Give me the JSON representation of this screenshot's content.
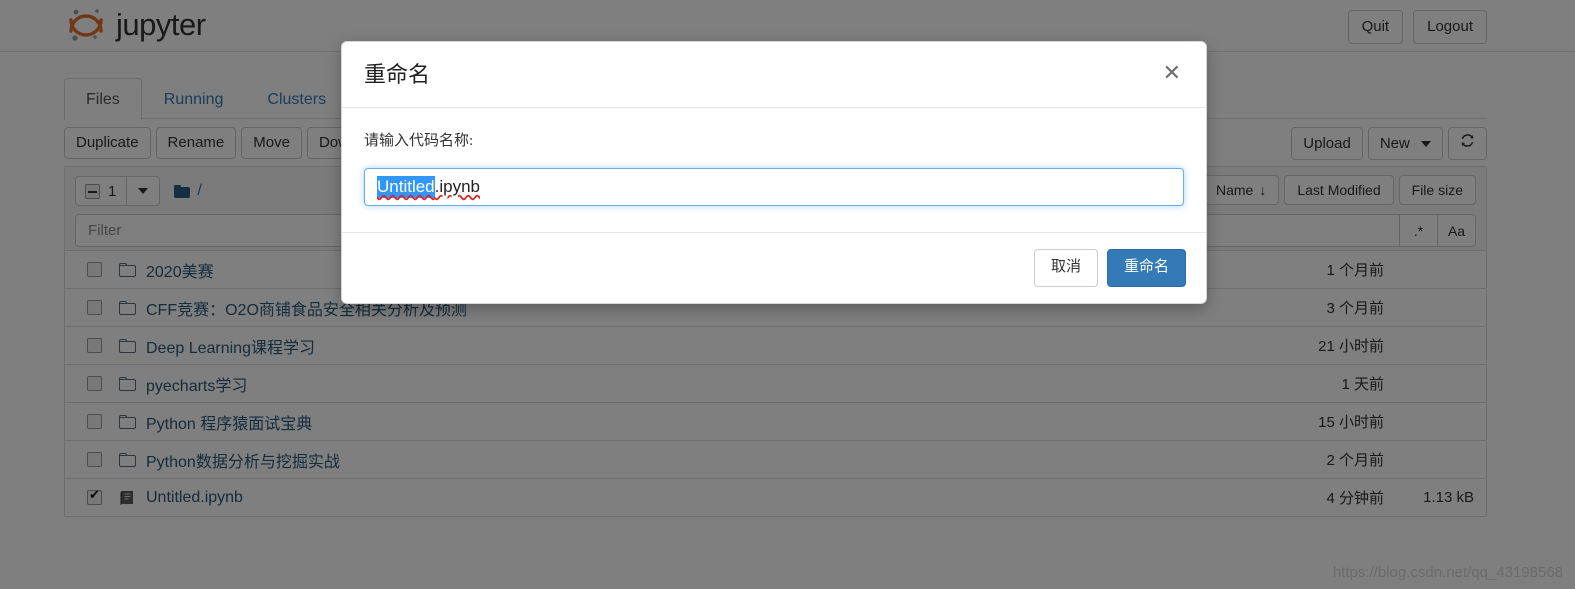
{
  "header": {
    "logo_text": "jupyter",
    "logo_icon": "jupyter-logo-icon",
    "quit_label": "Quit",
    "logout_label": "Logout"
  },
  "tabs": [
    {
      "label": "Files",
      "active": true
    },
    {
      "label": "Running",
      "active": false
    },
    {
      "label": "Clusters",
      "active": false
    }
  ],
  "toolbar": {
    "buttons": [
      "Duplicate",
      "Rename",
      "Move",
      "Download"
    ],
    "upload_label": "Upload",
    "new_label": "New",
    "refresh_icon": "refresh-icon"
  },
  "list_header": {
    "selected_count": "1",
    "select_all_state": "indeterminate",
    "breadcrumb_root": "/",
    "breadcrumb_icon": "folder-icon",
    "sort_name_label": "Name",
    "sort_name_direction": "↓",
    "sort_modified_label": "Last Modified",
    "sort_size_label": "File size",
    "filter_placeholder": "Filter",
    "filter_value": "",
    "regex_toggle_label": ".*",
    "case_toggle_label": "Aa"
  },
  "files": [
    {
      "name": "2020美赛",
      "type": "folder",
      "icon": "folder-icon",
      "checked": false,
      "modified": "1 个月前",
      "size": ""
    },
    {
      "name": "CFF竞赛：O2O商铺食品安全相关分析及预测",
      "type": "folder",
      "icon": "folder-icon",
      "checked": false,
      "modified": "3 个月前",
      "size": ""
    },
    {
      "name": "Deep Learning课程学习",
      "type": "folder",
      "icon": "folder-icon",
      "checked": false,
      "modified": "21 小时前",
      "size": ""
    },
    {
      "name": "pyecharts学习",
      "type": "folder",
      "icon": "folder-icon",
      "checked": false,
      "modified": "1 天前",
      "size": ""
    },
    {
      "name": "Python 程序猿面试宝典",
      "type": "folder",
      "icon": "folder-icon",
      "checked": false,
      "modified": "15 小时前",
      "size": ""
    },
    {
      "name": "Python数据分析与挖掘实战",
      "type": "folder",
      "icon": "folder-icon",
      "checked": false,
      "modified": "2 个月前",
      "size": ""
    },
    {
      "name": "Untitled.ipynb",
      "type": "notebook",
      "icon": "notebook-icon",
      "checked": true,
      "modified": "4 分钟前",
      "size": "1.13 kB"
    }
  ],
  "dialog": {
    "title": "重命名",
    "close_icon": "close-icon",
    "label": "请输入代码名称:",
    "input_selected_text": "Untitled",
    "input_trailing_text": ".ipynb",
    "cancel_label": "取消",
    "confirm_label": "重命名"
  },
  "watermark": "https://blog.csdn.net/qq_43198568",
  "colors": {
    "brand_orange": "#e46e2e",
    "link_blue": "#337ab7",
    "primary_button": "#337ab7",
    "selection_blue": "#3297fd",
    "file_name_blue": "#2b587a"
  }
}
